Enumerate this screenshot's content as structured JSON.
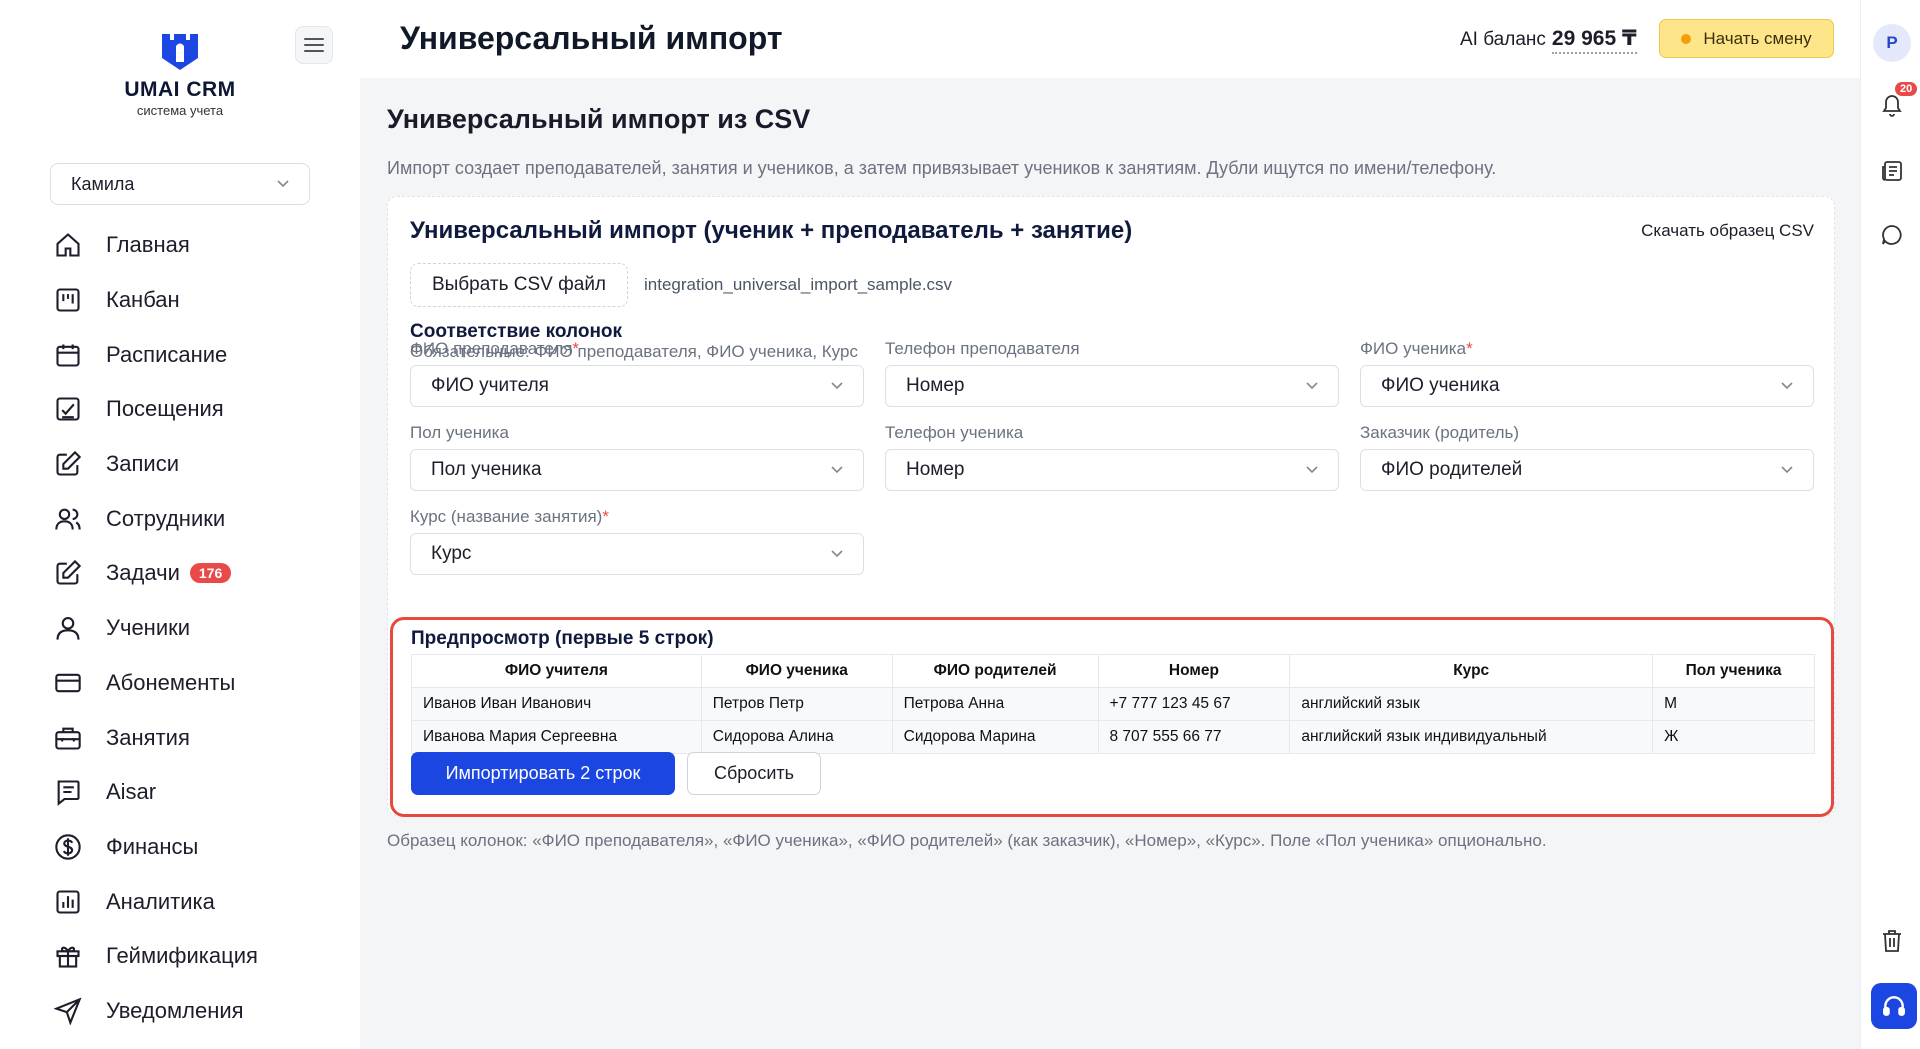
{
  "brand": {
    "name": "UMAI CRM",
    "tagline": "система учета",
    "color": "#1c46e2"
  },
  "sidebar": {
    "user": "Камила",
    "items": [
      {
        "label": "Главная",
        "icon": "home-icon"
      },
      {
        "label": "Канбан",
        "icon": "kanban-icon"
      },
      {
        "label": "Расписание",
        "icon": "calendar-icon"
      },
      {
        "label": "Посещения",
        "icon": "attendance-icon"
      },
      {
        "label": "Записи",
        "icon": "edit-icon"
      },
      {
        "label": "Сотрудники",
        "icon": "staff-icon"
      },
      {
        "label": "Задачи",
        "icon": "tasks-icon",
        "badge": "176"
      },
      {
        "label": "Ученики",
        "icon": "user-icon"
      },
      {
        "label": "Абонементы",
        "icon": "card-icon"
      },
      {
        "label": "Занятия",
        "icon": "briefcase-icon"
      },
      {
        "label": "Aisar",
        "icon": "chat-list-icon"
      },
      {
        "label": "Финансы",
        "icon": "dollar-icon"
      },
      {
        "label": "Аналитика",
        "icon": "analytics-icon"
      },
      {
        "label": "Геймификация",
        "icon": "gift-icon"
      },
      {
        "label": "Уведомления",
        "icon": "send-icon"
      }
    ]
  },
  "header": {
    "title": "Универсальный импорт",
    "balance_label": "AI баланс",
    "balance_value": "29 965 ₸",
    "shift_button": "Начать смену"
  },
  "rail": {
    "avatar": "P",
    "notifications": "20"
  },
  "main": {
    "heading": "Универсальный импорт из CSV",
    "description": "Импорт создает преподавателей, занятия и учеников, а затем привязывает учеников к занятиям. Дубли ищутся по имени/телефону.",
    "card": {
      "title": "Универсальный импорт (ученик + преподаватель + занятие)",
      "download_link": "Скачать образец CSV",
      "file_button": "Выбрать CSV файл",
      "file_name": "integration_universal_import_sample.csv",
      "mapping_title": "Соответствие колонок",
      "mapping_subtitle": "Обязательные: ФИО преподавателя, ФИО ученика, Курс",
      "fields": [
        {
          "label": "ФИО преподавателя",
          "required": "*",
          "value": "ФИО учителя"
        },
        {
          "label": "Телефон преподавателя",
          "required": "",
          "value": "Номер"
        },
        {
          "label": "ФИО ученика",
          "required": "*",
          "value": "ФИО ученика"
        },
        {
          "label": "Пол ученика",
          "required": "",
          "value": "Пол ученика"
        },
        {
          "label": "Телефон ученика",
          "required": "",
          "value": "Номер"
        },
        {
          "label": "Заказчик (родитель)",
          "required": "",
          "value": "ФИО родителей"
        },
        {
          "label": "Курс (название занятия)",
          "required": "*",
          "value": "Курс"
        }
      ],
      "preview": {
        "title": "Предпросмотр (первые 5 строк)",
        "columns": [
          "ФИО учителя",
          "ФИО ученика",
          "ФИО родителей",
          "Номер",
          "Курс",
          "Пол ученика"
        ],
        "rows": [
          [
            "Иванов Иван Иванович",
            "Петров Петр",
            "Петрова Анна",
            "+7 777 123 45 67",
            "английский язык",
            "М"
          ],
          [
            "Иванова Мария Сергеевна",
            "Сидорова Алина",
            "Сидорова Марина",
            "8 707 555 66 77",
            "английский язык индивидуальный",
            "Ж"
          ]
        ],
        "import_button": "Импортировать 2 строк",
        "reset_button": "Сбросить"
      }
    },
    "footnote": "Образец колонок: «ФИО преподавателя», «ФИО ученика», «ФИО родителей» (как заказчик), «Номер», «Курс». Поле «Пол ученика» опционально."
  }
}
